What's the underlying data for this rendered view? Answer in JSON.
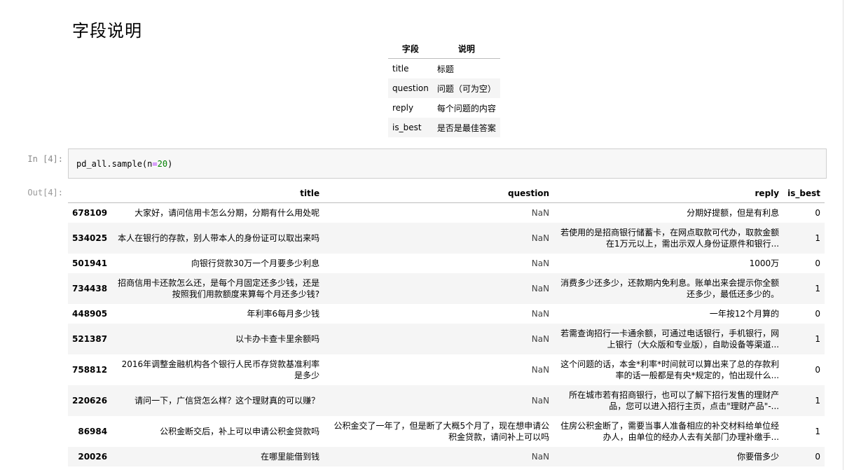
{
  "heading": "字段说明",
  "field_table": {
    "headers": [
      "字段",
      "说明"
    ],
    "rows": [
      [
        "title",
        "标题"
      ],
      [
        "question",
        "问题（可为空）"
      ],
      [
        "reply",
        "每个问题的内容"
      ],
      [
        "is_best",
        "是否是最佳答案"
      ]
    ]
  },
  "code_cell": {
    "prompt": "In [4]:",
    "code_prefix": "pd_all.sample(n",
    "code_eq": "=",
    "code_num": "20",
    "code_suffix": ")"
  },
  "output": {
    "prompt": "Out[4]:",
    "columns": [
      "",
      "title",
      "question",
      "reply",
      "is_best"
    ],
    "rows": [
      {
        "index": "678109",
        "title": "大家好，请问信用卡怎么分期，分期有什么用处呢",
        "question": "NaN",
        "reply": "分期好提额，但是有利息",
        "is_best": "0"
      },
      {
        "index": "534025",
        "title": "本人在银行的存款，别人带本人的身份证可以取出来吗",
        "question": "NaN",
        "reply": "若使用的是招商银行储蓄卡，在网点取款可代办，取款金额在1万元以上，需出示双人身份证原件和银行...",
        "is_best": "1"
      },
      {
        "index": "501941",
        "title": "向银行贷款30万一个月要多少利息",
        "question": "NaN",
        "reply": "1000万",
        "is_best": "0"
      },
      {
        "index": "734438",
        "title": "招商信用卡还款怎么还，是每个月固定还多少钱，还是按照我们用款额度来算每个月还多少钱?",
        "question": "NaN",
        "reply": "消费多少还多少，还款期内免利息。账单出来会提示你全额还多少，最低还多少的。",
        "is_best": "1"
      },
      {
        "index": "448905",
        "title": "年利率6每月多少钱",
        "question": "NaN",
        "reply": "一年按12个月算的",
        "is_best": "0"
      },
      {
        "index": "521387",
        "title": "以卡办卡查卡里余额吗",
        "question": "NaN",
        "reply": "若需查询招行一卡通余额，可通过电话银行，手机银行，网上银行（大众版和专业版），自助设备等渠道...",
        "is_best": "1"
      },
      {
        "index": "758812",
        "title": "2016年调整金融机构各个银行人民币存贷款基准利率是多少",
        "question": "NaN",
        "reply": "这个问题的话，本金*利率*时间就可以算出来了总的存款利率的话一般都是有央*规定的，怕出现什么...",
        "is_best": "0"
      },
      {
        "index": "220626",
        "title": "请问一下，广信贷怎么样？这个理财真的可以赚？",
        "question": "NaN",
        "reply": "所在城市若有招商银行，也可以了解下招行发售的理财产品，您可以进入招行主页，点击\"理财产品\"-...",
        "is_best": "1"
      },
      {
        "index": "86984",
        "title": "公积金断交后，补上可以申请公积金贷款吗",
        "question": "公积金交了一年了，但是断了大概5个月了，现在想申请公积金贷款，请问补上可以吗",
        "reply": "住房公积金断了，需要当事人准备相应的补交材料给单位经办人，由单位的经办人去有关部门办理补缴手...",
        "is_best": "1"
      },
      {
        "index": "20026",
        "title": "在哪里能借到钱",
        "question": "NaN",
        "reply": "你要借多少",
        "is_best": "0"
      }
    ]
  }
}
